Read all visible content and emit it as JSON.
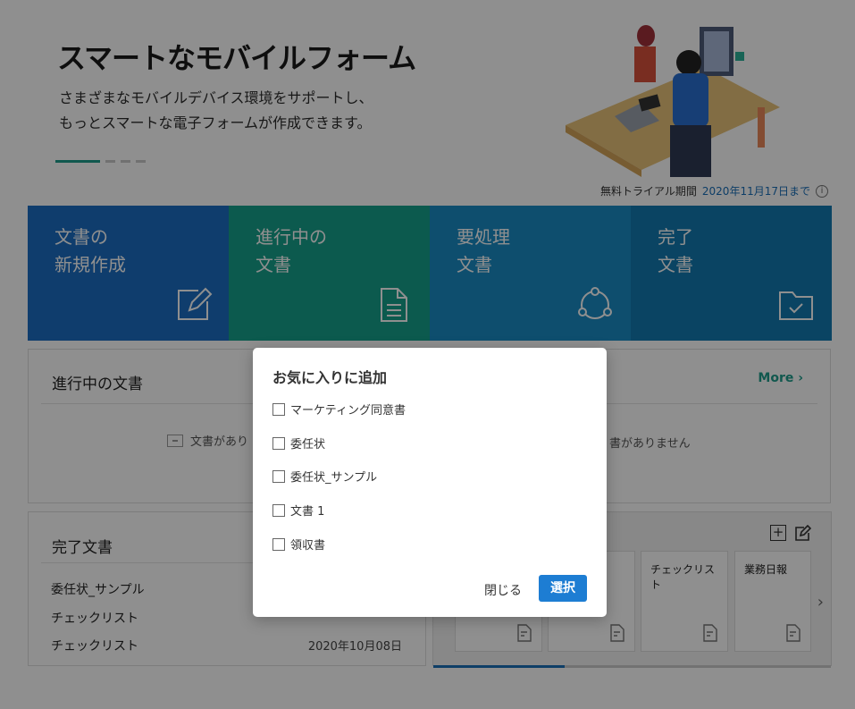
{
  "hero": {
    "title": "スマートなモバイルフォーム",
    "subtitle_line1": "さまざまなモバイルデバイス環境をサポートし、",
    "subtitle_line2": "もっとスマートな電子フォームが作成できます。"
  },
  "trial": {
    "label": "無料トライアル期間",
    "date": "2020年11月17日まで",
    "info_icon": "info-circle-icon"
  },
  "tiles": [
    {
      "label": "文書の\n新規作成",
      "icon": "edit-document-icon",
      "color": "#1b6ec2"
    },
    {
      "label": "進行中の\n文書",
      "icon": "document-lines-icon",
      "color": "#16a08b"
    },
    {
      "label": "要処理\n文書",
      "icon": "cycle-icon",
      "color": "#1a8cc4"
    },
    {
      "label": "完了\n文書",
      "icon": "folder-check-icon",
      "color": "#127ab0"
    }
  ],
  "in_progress": {
    "title": "進行中の文書",
    "more": "More ›",
    "empty_left": "文書があり",
    "empty_right": "書がありません"
  },
  "completed": {
    "title": "完了文書",
    "rows": [
      {
        "name": "委任状_サンプル",
        "date": ""
      },
      {
        "name": "チェックリスト",
        "date": ""
      },
      {
        "name": "チェックリスト",
        "date": "2020年10月08日"
      }
    ]
  },
  "favorites": {
    "cards": [
      {
        "label": ""
      },
      {
        "label": ""
      },
      {
        "label": "チェックリスト"
      },
      {
        "label": "業務日報"
      }
    ],
    "progress": 0.33
  },
  "modal": {
    "title": "お気に入りに追加",
    "options": [
      "マーケティング同意書",
      "委任状",
      "委任状_サンプル",
      "文書 1",
      "領収書"
    ],
    "close_label": "閉じる",
    "select_label": "選択"
  }
}
